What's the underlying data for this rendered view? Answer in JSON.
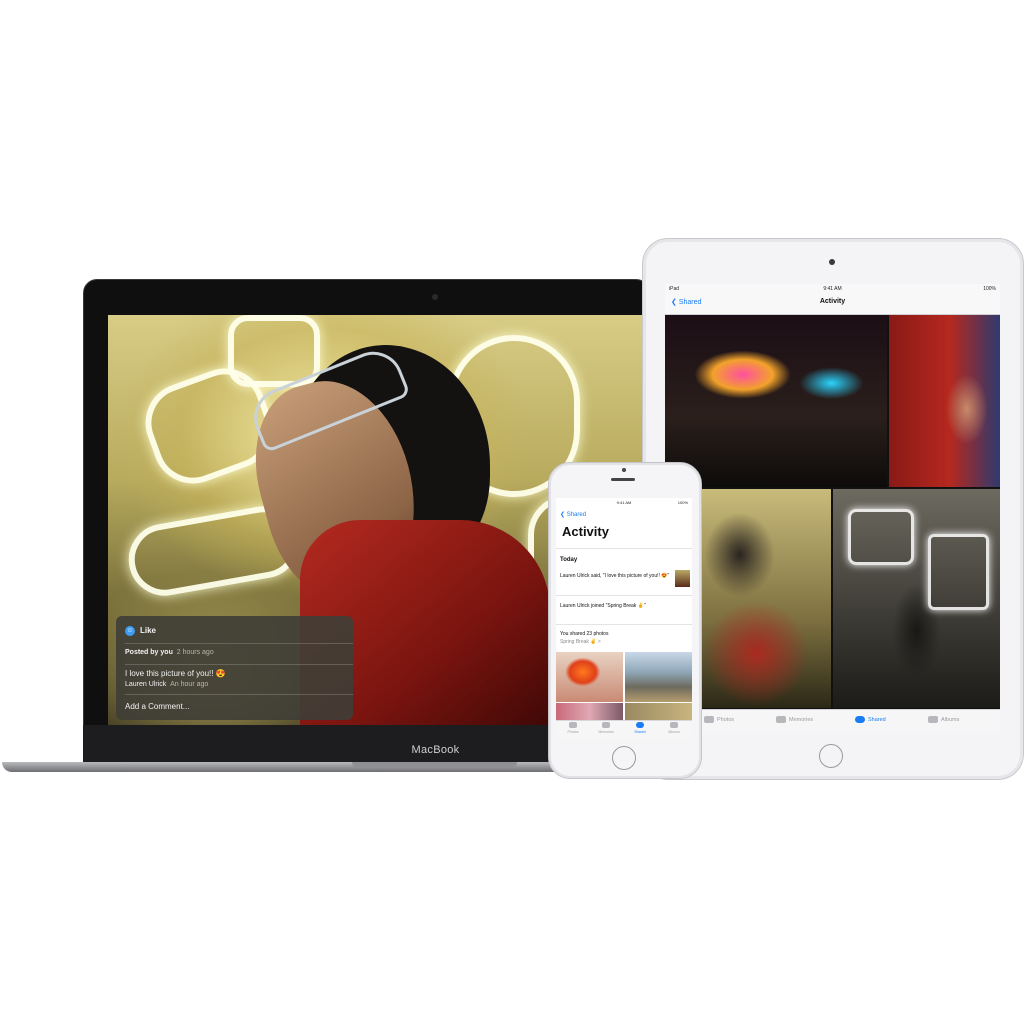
{
  "macbook": {
    "brand_label": "MacBook",
    "comment_panel": {
      "like_label": "Like",
      "posted_by": "Posted by you",
      "posted_time": "2 hours ago",
      "comment_text": "I love this picture of you!! 😍",
      "comment_author": "Lauren Ulrick",
      "comment_time": "An hour ago",
      "add_comment_placeholder": "Add a Comment..."
    }
  },
  "ipad": {
    "status": {
      "carrier": "iPad",
      "time": "9:41 AM",
      "battery": "100%"
    },
    "nav": {
      "back_label": "Shared",
      "title": "Activity"
    },
    "tabs": [
      {
        "label": "Photos",
        "icon": "photos-icon",
        "active": false
      },
      {
        "label": "Memories",
        "icon": "memories-icon",
        "active": false
      },
      {
        "label": "Shared",
        "icon": "cloud-icon",
        "active": true
      },
      {
        "label": "Albums",
        "icon": "albums-icon",
        "active": false
      }
    ]
  },
  "iphone": {
    "status": {
      "time": "9:41 AM",
      "battery": "100%"
    },
    "nav": {
      "back_label": "Shared",
      "title": "Activity"
    },
    "section_header": "Today",
    "items": [
      {
        "text": "Lauren Ulrick said, \"I love this picture of you!! 😍\"",
        "sub": ""
      },
      {
        "text": "Lauren Ulrick joined \"Spring Break ✌️\"",
        "sub": ""
      },
      {
        "text": "You shared 23 photos",
        "sub": "Spring Break ✌️ >"
      }
    ],
    "tabs": [
      {
        "label": "Photos",
        "active": false
      },
      {
        "label": "Memories",
        "active": false
      },
      {
        "label": "Shared",
        "active": true
      },
      {
        "label": "Albums",
        "active": false
      }
    ]
  },
  "colors": {
    "accent": "#1a7cf5",
    "panel_bg": "#403e36"
  }
}
